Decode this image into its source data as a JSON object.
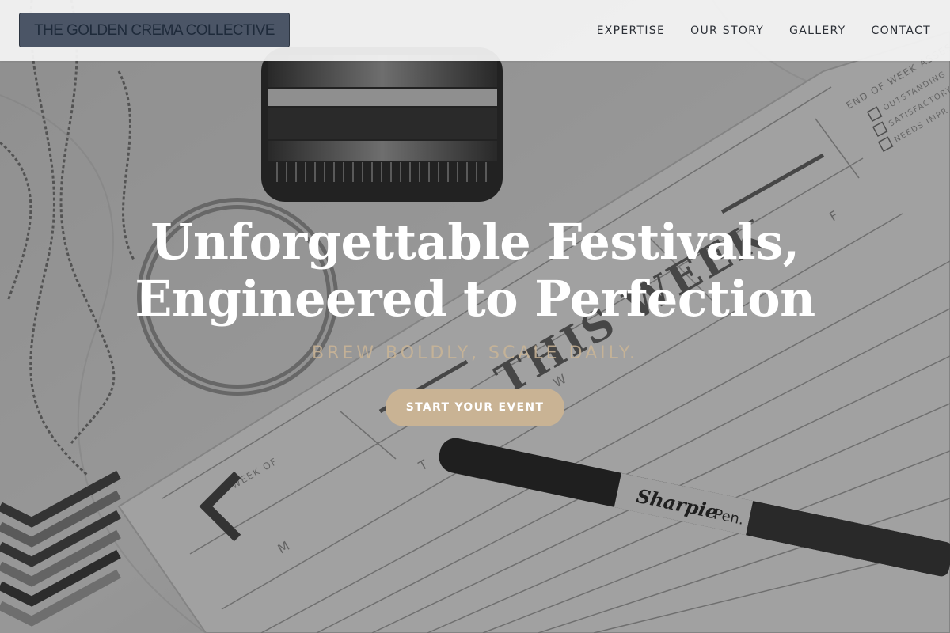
{
  "header": {
    "brand": "THE GOLDEN CREMA COLLECTIVE",
    "nav": [
      {
        "label": "EXPERTISE"
      },
      {
        "label": "OUR STORY"
      },
      {
        "label": "GALLERY"
      },
      {
        "label": "CONTACT"
      }
    ]
  },
  "hero": {
    "title_line1": "Unforgettable Festivals,",
    "title_line2": "Engineered to Perfection",
    "tagline": "BREW BOLDLY, SCALE DAILY.",
    "cta_label": "START YOUR EVENT",
    "image": {
      "week_of": "WEEK OF",
      "this_week": "THIS WEEK",
      "end_of_week": "END OF WEEK ASSESSMENT",
      "outstanding": "OUTSTANDING",
      "satisfactory": "SATISFACTORY",
      "needs_improvement": "NEEDS IMPR",
      "day_t": "T",
      "day_w": "W",
      "day_f": "F",
      "day_m": "M",
      "pen_brand": "Sharpie",
      "pen_type": "Pen."
    }
  },
  "colors": {
    "accent": "#c9b394",
    "brand_bg": "#4b5566",
    "header_bg": "#f5f5f5",
    "nav_text": "#2b2f36"
  }
}
